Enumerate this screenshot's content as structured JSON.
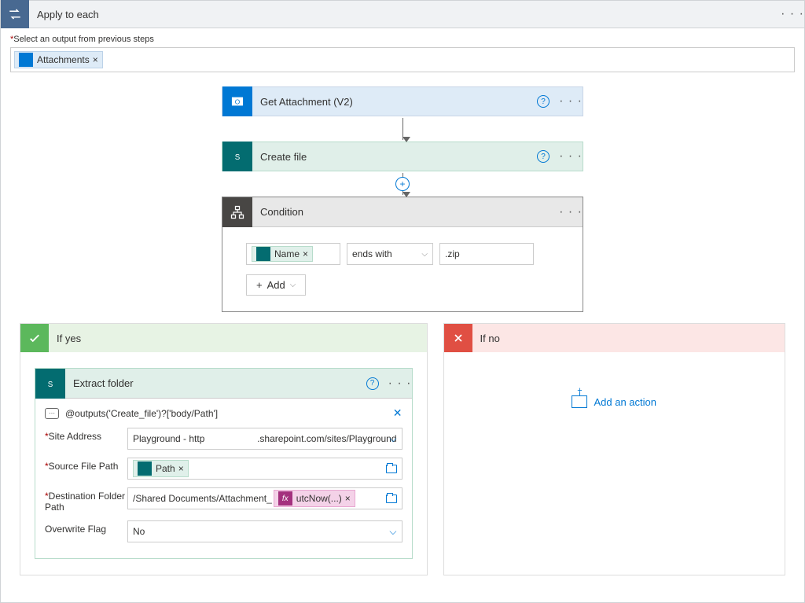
{
  "loop": {
    "title": "Apply to each"
  },
  "selectLabel": "Select an output from previous steps",
  "attachmentToken": "Attachments",
  "getAttachment": {
    "title": "Get Attachment (V2)"
  },
  "createFile": {
    "title": "Create file"
  },
  "condition": {
    "title": "Condition",
    "nameToken": "Name",
    "operator": "ends with",
    "value": ".zip",
    "addLabel": "Add"
  },
  "ifYes": {
    "title": "If yes"
  },
  "ifNo": {
    "title": "If no",
    "addAction": "Add an action"
  },
  "extract": {
    "title": "Extract folder",
    "comment": "@outputs('Create_file')?['body/Path']",
    "siteLabel": "Site Address",
    "siteValue": "Playground - http                    .sharepoint.com/sites/Playground",
    "srcLabel": "Source File Path",
    "srcToken": "Path",
    "dstLabel": "Destination Folder Path",
    "dstPrefix": "/Shared Documents/Attachment_",
    "dstFx": "utcNow(...)",
    "ovLabel": "Overwrite Flag",
    "ovValue": "No"
  }
}
